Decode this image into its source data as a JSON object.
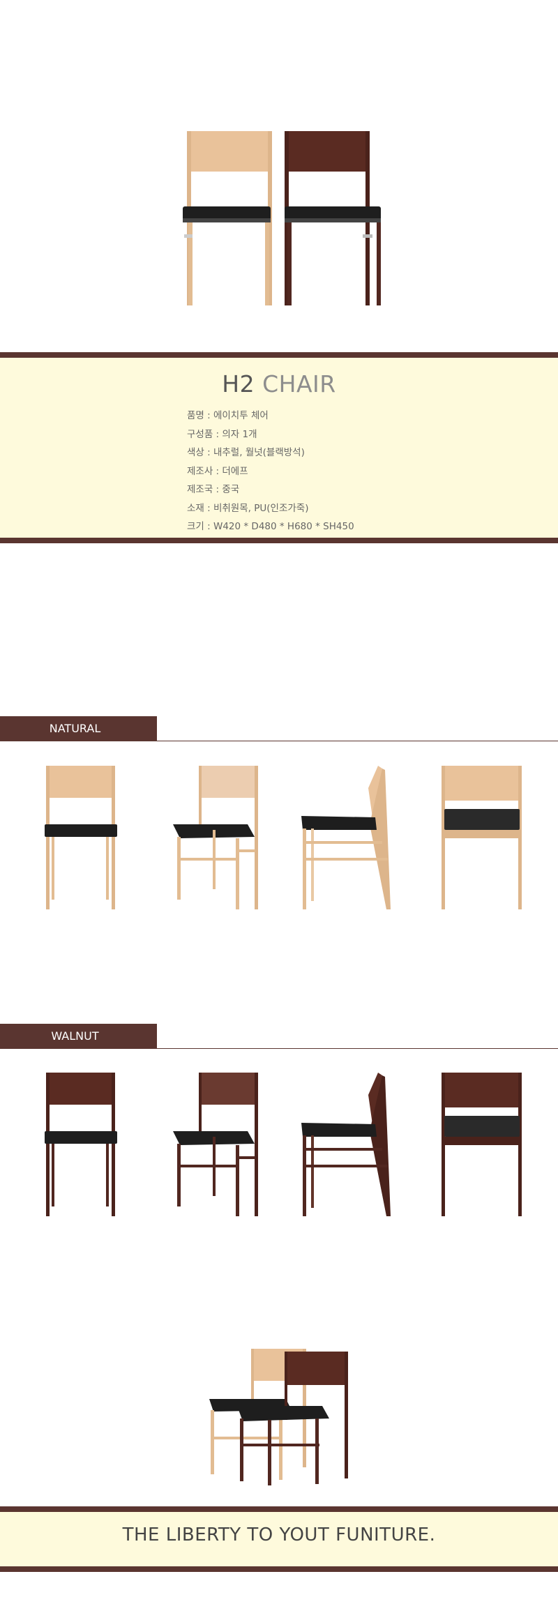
{
  "product": {
    "title_code": "H2",
    "title_name": "CHAIR",
    "specs": [
      "품명 : 에이치투 체어",
      "구성품 : 의자 1개",
      "색상 : 내추럴, 월넛(블랙방석)",
      "제조사 : 더에프",
      "제조국 : 중국",
      "소재 : 비취원목, PU(인조가죽)",
      "크기 : W420 * D480 * H680 * SH450"
    ]
  },
  "sections": {
    "natural": {
      "label": "NATURAL"
    },
    "walnut": {
      "label": "WALNUT"
    }
  },
  "footer": {
    "slogan": "THE LIBERTY TO YOUT FUNITURE."
  },
  "colors": {
    "brown_band": "#5a3530",
    "cream_band": "#fefadc",
    "natural_wood": "#e9c29a",
    "walnut_wood": "#5a2b22",
    "seat_black": "#1e1e1e"
  },
  "images": [
    "natural-front-chair",
    "walnut-front-chair",
    "natural-front-view",
    "natural-three-quarter-view",
    "natural-side-view",
    "natural-back-view",
    "walnut-front-view",
    "walnut-three-quarter-view",
    "walnut-side-view",
    "walnut-back-view",
    "natural-and-walnut-pair"
  ]
}
